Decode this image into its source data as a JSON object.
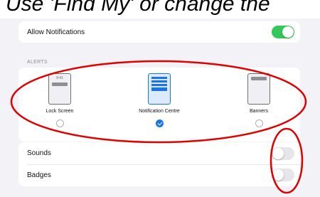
{
  "caption": {
    "text": "Use 'Find My' or change the"
  },
  "notifications": {
    "label": "Allow Notifications",
    "enabled": true
  },
  "alerts": {
    "header": "ALERTS",
    "options": [
      {
        "label": "Lock Screen",
        "preview_time": "9:41",
        "selected": false
      },
      {
        "label": "Notification Centre",
        "selected": true
      },
      {
        "label": "Banners",
        "selected": false
      }
    ]
  },
  "sounds": {
    "label": "Sounds",
    "enabled": false
  },
  "badges": {
    "label": "Badges",
    "enabled": false
  },
  "colors": {
    "accent": "#1a73e8",
    "toggle_on": "#34c759",
    "annotation": "#e00000"
  }
}
